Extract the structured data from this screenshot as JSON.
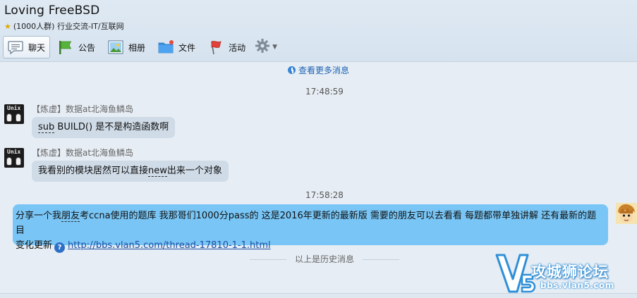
{
  "group": {
    "name": "Loving FreeBSD",
    "info": "(1000人群) 行业交流-IT/互联网"
  },
  "toolbar": {
    "items": [
      {
        "label": "聊天",
        "icon": "chat-bubble-icon"
      },
      {
        "label": "公告",
        "icon": "flag-icon"
      },
      {
        "label": "相册",
        "icon": "photo-icon"
      },
      {
        "label": "文件",
        "icon": "folder-icon"
      },
      {
        "label": "活动",
        "icon": "event-flag-icon"
      }
    ],
    "settings_icon": "gear-icon"
  },
  "chat": {
    "view_more": "查看更多消息",
    "messages": [
      {
        "time": "17:48:59"
      },
      {
        "sender": "【炼虚】数据at北海鱼鳞岛",
        "pre": "",
        "dashed": "sub",
        "post": " BUILD() 是不是构造函数啊"
      },
      {
        "sender": "【炼虚】数据at北海鱼鳞岛",
        "pre": "我看别的模块居然可以直接",
        "dashed": "new",
        "post": "出来一个对象"
      },
      {
        "time": "17:58:28"
      },
      {
        "line1_pre": "分享一个我",
        "line1_dashed": "朋友",
        "line1_post": "考ccna使用的题库 我那哥们1000分pass的 这是2016年更新的最新版 需要的朋友可以去看看 每题都带单独讲解 还有最新的题目",
        "line2_pre": "变化更新",
        "link": "http://bbs.vlan5.com/thread-17810-1-1.html"
      }
    ],
    "history_label": "以上是历史消息"
  },
  "watermark": {
    "logo_text": "V5",
    "name": "攻城狮论坛",
    "url": "bbs.vlan5.com"
  },
  "colors": {
    "accent": "#1f63b3",
    "my_bubble": "#79c6f6",
    "their_bubble": "#cfdbe7"
  }
}
